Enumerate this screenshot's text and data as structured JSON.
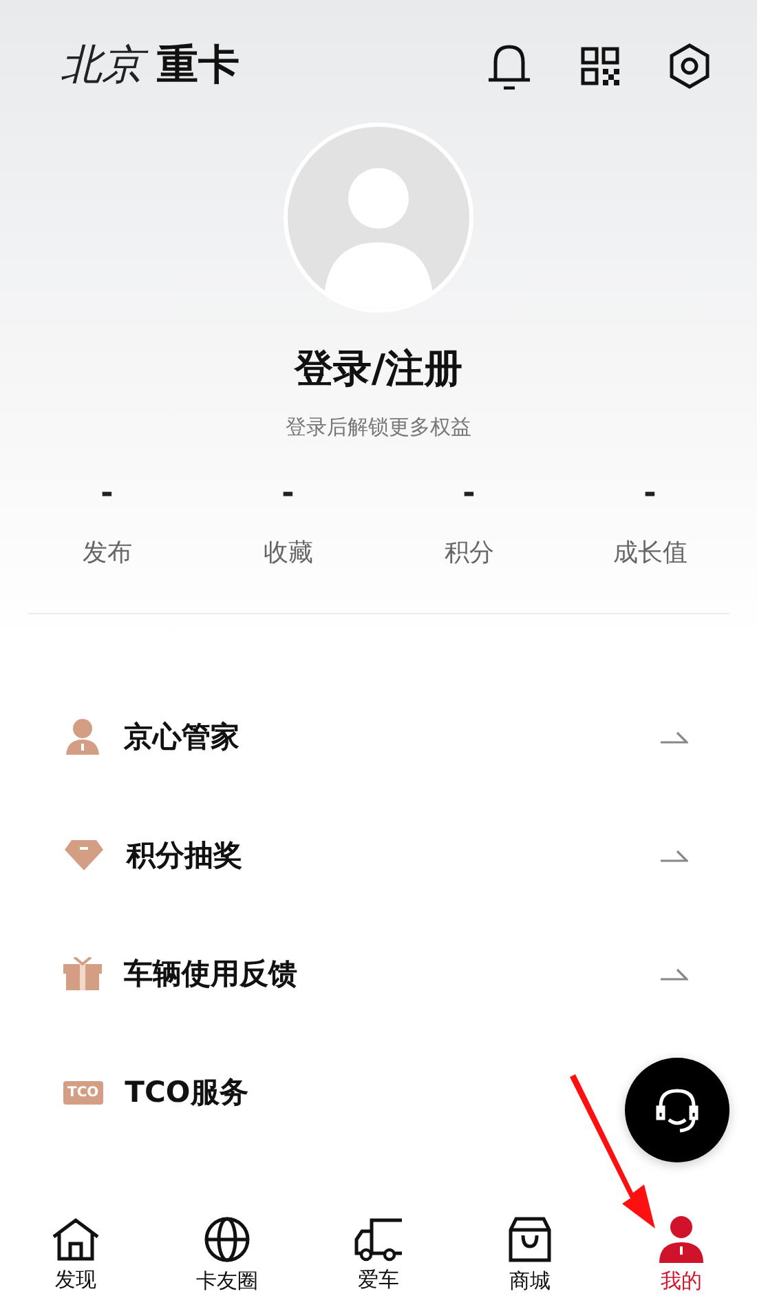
{
  "header": {
    "logo": [
      "北京",
      "重卡"
    ]
  },
  "profile": {
    "title": "登录/注册",
    "subtitle": "登录后解锁更多权益"
  },
  "stats": [
    {
      "value": "-",
      "label": "发布"
    },
    {
      "value": "-",
      "label": "收藏"
    },
    {
      "value": "-",
      "label": "积分"
    },
    {
      "value": "-",
      "label": "成长值"
    }
  ],
  "menu": [
    {
      "kind": "person",
      "label": "京心管家",
      "arrow": true
    },
    {
      "kind": "diamond",
      "label": "积分抽奖",
      "arrow": true
    },
    {
      "kind": "gift",
      "label": "车辆使用反馈",
      "arrow": true
    },
    {
      "kind": "tco",
      "badge": "TCO",
      "label": "TCO服务",
      "arrow": false
    }
  ],
  "tabs": [
    {
      "kind": "home",
      "label": "发现",
      "selected": false
    },
    {
      "kind": "globe",
      "label": "卡友圈",
      "selected": false
    },
    {
      "kind": "truck",
      "label": "爱车",
      "selected": false
    },
    {
      "kind": "bag",
      "label": "商城",
      "selected": false
    },
    {
      "kind": "me",
      "label": "我的",
      "selected": true
    }
  ]
}
